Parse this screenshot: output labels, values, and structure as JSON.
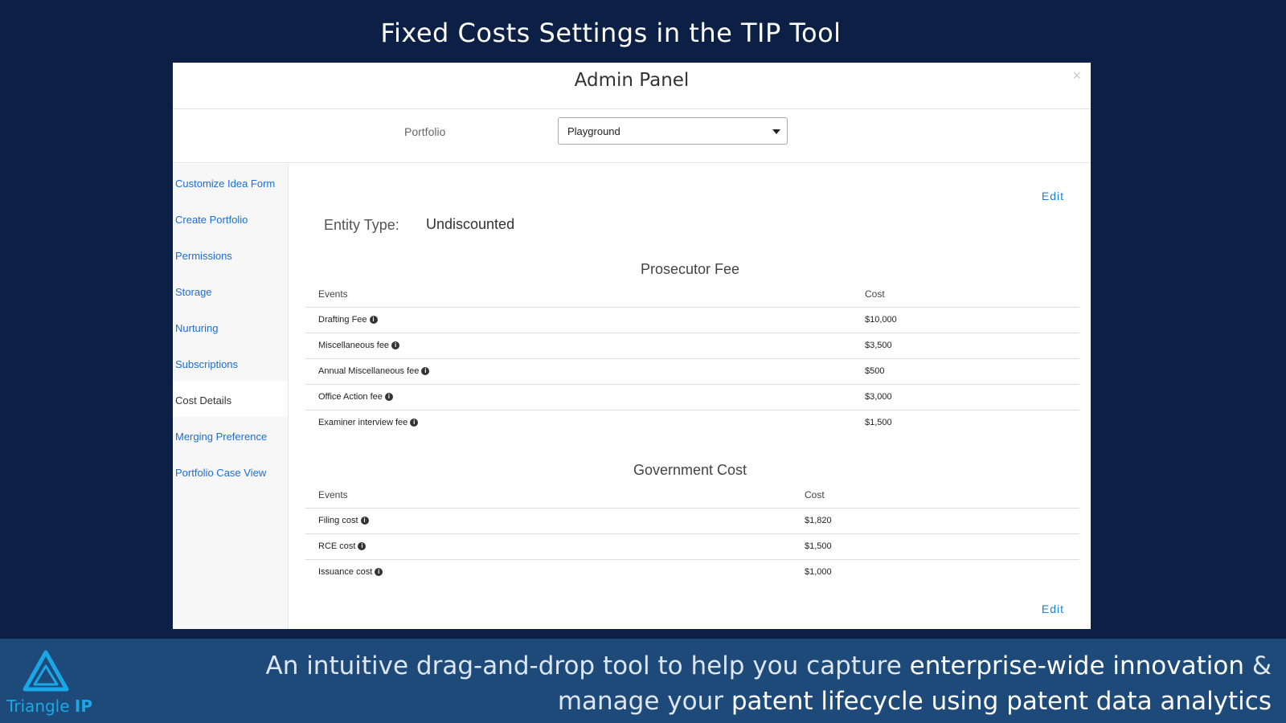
{
  "slide": {
    "title": "Fixed Costs Settings in the TIP Tool"
  },
  "modal": {
    "title": "Admin Panel",
    "close_label": "×",
    "portfolio_label": "Portfolio",
    "portfolio_value": "Playground"
  },
  "sidebar": {
    "items": [
      {
        "label": "Customize Idea Form"
      },
      {
        "label": "Create Portfolio"
      },
      {
        "label": "Permissions"
      },
      {
        "label": "Storage"
      },
      {
        "label": "Nurturing"
      },
      {
        "label": "Subscriptions"
      },
      {
        "label": "Cost Details"
      },
      {
        "label": "Merging Preference"
      },
      {
        "label": "Portfolio Case View"
      }
    ],
    "active_index": 6
  },
  "content": {
    "edit_label": "Edit",
    "entity_type_label": "Entity Type:",
    "entity_type_value": "Undiscounted",
    "prosecutor": {
      "title": "Prosecutor Fee",
      "headers": [
        "Events",
        "Cost"
      ],
      "rows": [
        {
          "event": "Drafting Fee",
          "cost": "$10,000"
        },
        {
          "event": "Miscellaneous fee",
          "cost": "$3,500"
        },
        {
          "event": "Annual Miscellaneous fee",
          "cost": "$500"
        },
        {
          "event": "Office Action fee",
          "cost": "$3,000"
        },
        {
          "event": "Examiner interview fee",
          "cost": "$1,500"
        }
      ]
    },
    "government": {
      "title": "Government Cost",
      "headers": [
        "Events",
        "Cost"
      ],
      "rows": [
        {
          "event": "Filing cost",
          "cost": "$1,820"
        },
        {
          "event": "RCE cost",
          "cost": "$1,500"
        },
        {
          "event": "Issuance cost",
          "cost": "$1,000"
        }
      ]
    },
    "info_glyph": "i"
  },
  "footer": {
    "logo_text": "Triangle",
    "logo_text_bold": "IP",
    "tagline_part1": "An intuitive drag-and-drop tool to help you capture ",
    "tagline_hl1": "enterprise-wide innovation",
    "tagline_part2": " & manage your ",
    "tagline_hl2": "patent lifecycle using patent data analytics"
  },
  "colors": {
    "background": "#0c1f45",
    "footer": "#1e4a7a",
    "link": "#1a6dd8",
    "logo": "#19a7e6"
  }
}
